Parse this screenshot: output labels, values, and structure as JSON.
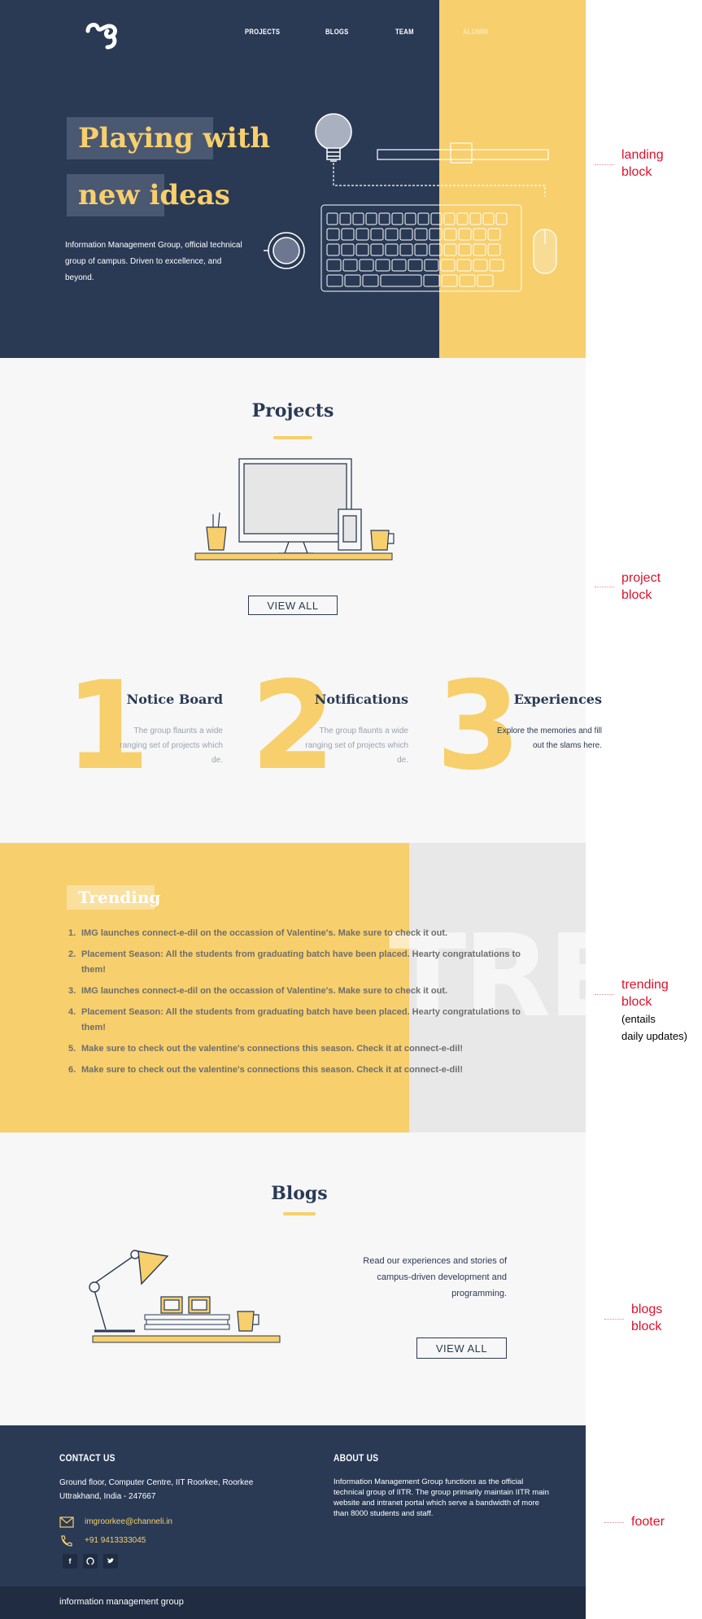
{
  "nav": {
    "logo_name": "img-logo",
    "items": [
      "PROJECTS",
      "BLOGS",
      "TEAM",
      "ALUMNI"
    ]
  },
  "landing": {
    "title_line1": "Playing with",
    "title_line2": "new ideas",
    "description": "Information Management Group, official technical group of campus. Driven to excellence, and beyond."
  },
  "projects": {
    "title": "Projects",
    "view_all": "VIEW ALL",
    "features": [
      {
        "number": "1",
        "title": "Notice Board",
        "desc": "The group flaunts a wide ranging set of projects which de."
      },
      {
        "number": "2",
        "title": "Notifications",
        "desc": "The group flaunts a wide ranging set of projects which de."
      },
      {
        "number": "3",
        "title": "Experiences",
        "desc": "Explore the memories and fill out the slams here."
      }
    ]
  },
  "trending": {
    "title": "Trending",
    "watermark": "TREI",
    "items": [
      "IMG launches connect-e-dil on the occassion of Valentine's. Make sure to check it out.",
      "Placement Season: All the students from graduating batch have been placed. Hearty congratulations to them!",
      "IMG launches connect-e-dil on the occassion of Valentine's. Make sure to check it out.",
      "Placement Season: All the students from graduating batch have been placed. Hearty congratulations to them!",
      "Make sure to check out the valentine's connections this season. Check it at connect-e-dil!",
      "Make sure to check out the valentine's connections this season. Check it at connect-e-dil!"
    ]
  },
  "blogs": {
    "title": "Blogs",
    "description": "Read our experiences and stories of campus-driven development and programming.",
    "view_all": "VIEW ALL"
  },
  "footer": {
    "contact_title": "CONTACT US",
    "address": "Ground floor, Computer Centre, IIT Roorkee, Roorkee Uttrakhand, India - 247667",
    "email": "imgroorkee@channeli.in",
    "phone": "+91 9413333045",
    "social": [
      "f",
      "gh",
      "tw"
    ],
    "about_title": "ABOUT US",
    "about_text": "Information Management Group functions as the official technical group of IITR. The group primarily maintain IITR main website and intranet portal which serve a bandwidth of more than 8000 students and staff.",
    "bottom_text": "information management group"
  },
  "annotations": {
    "landing": "landing\nblock",
    "project": "project\nblock",
    "trending": "trending\nblock",
    "trending_sub": "(entails\ndaily updates)",
    "blogs": "blogs\nblock",
    "footer": "footer"
  },
  "colors": {
    "navy": "#2a3a55",
    "yellow": "#f7cf6c",
    "light_bg": "#f7f7f7",
    "annotation_red": "#e0102a"
  }
}
